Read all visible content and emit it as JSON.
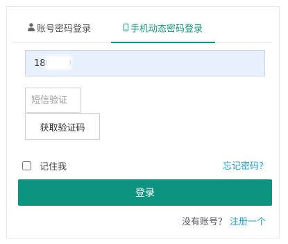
{
  "tabs": {
    "account_label": "账号密码登录",
    "mobile_label": "手机动态密码登录",
    "active_color": "#139a7f"
  },
  "form": {
    "phone_value": "180 980",
    "sms_placeholder": "短信验证",
    "get_code_label": "获取验证码",
    "remember_label": "记住我",
    "forgot_label": "忘记密码？",
    "login_label": "登录",
    "no_account_text": "没有账号？",
    "register_label": "注册一个"
  },
  "colors": {
    "primary": "#0d9480",
    "link": "#1e9fd8",
    "input_bg": "#e8f0fe"
  },
  "icons": {
    "account_tab": "user-icon",
    "mobile_tab": "mobile-phone-icon"
  }
}
